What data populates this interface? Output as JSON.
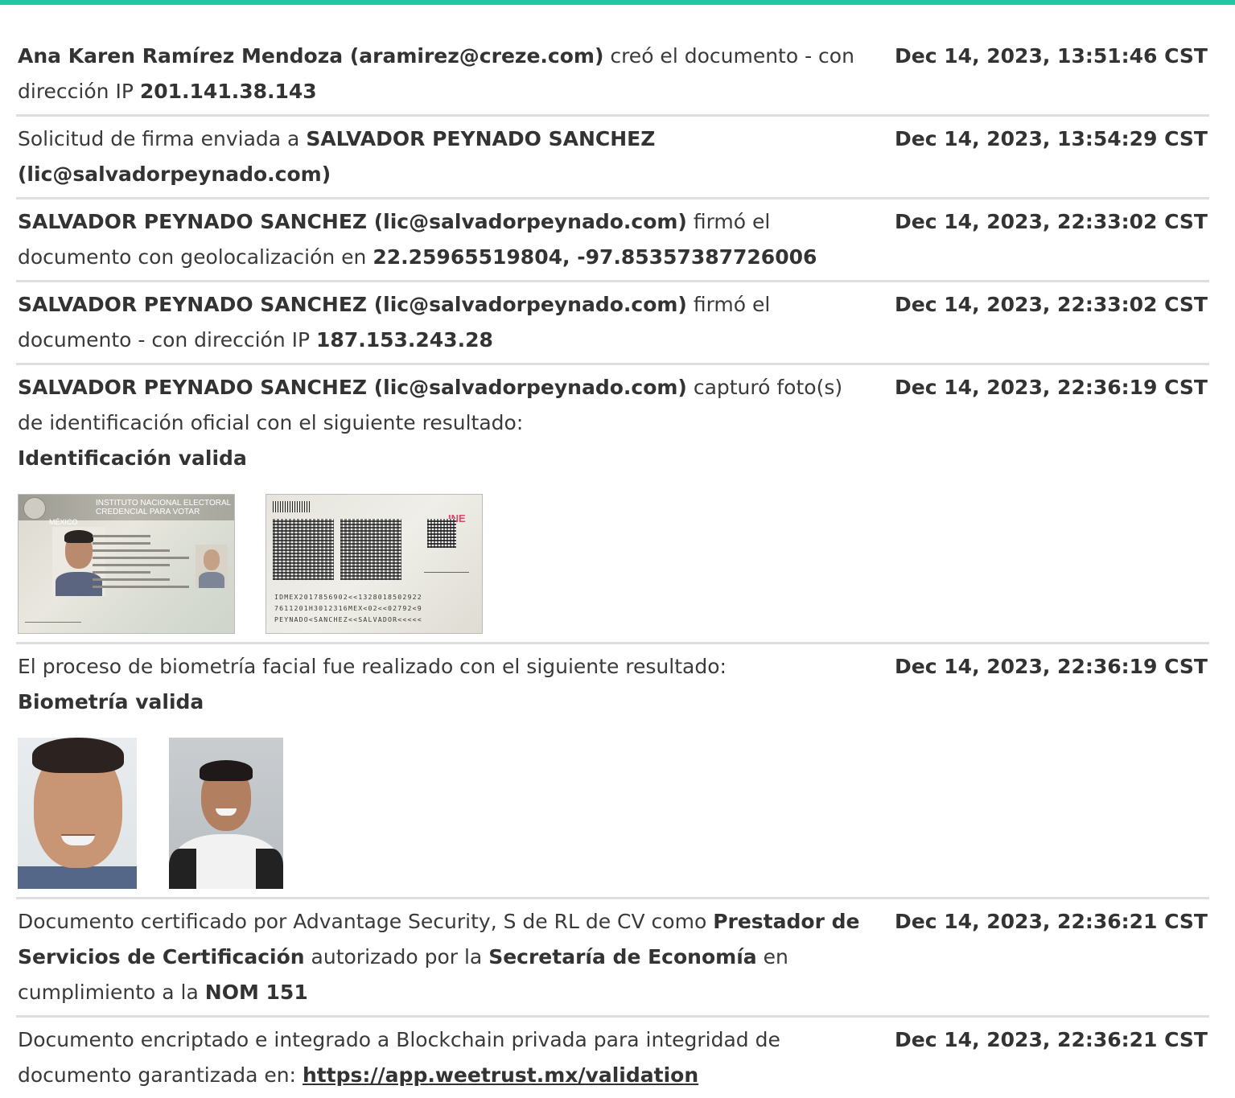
{
  "colors": {
    "accent": "#1fc7a0",
    "divider": "#dedede",
    "text": "#3a3a3a"
  },
  "events": [
    {
      "date": "Dec 14, 2023, 13:51:46 CST",
      "parts": [
        {
          "t": "Ana Karen Ramírez Mendoza (aramirez@creze.com)",
          "b": true
        },
        {
          "t": " creó el documento - con dirección IP ",
          "b": false
        },
        {
          "t": "201.141.38.143",
          "b": true
        }
      ]
    },
    {
      "date": "Dec 14, 2023, 13:54:29 CST",
      "parts": [
        {
          "t": "Solicitud de firma enviada a ",
          "b": false
        },
        {
          "t": "SALVADOR PEYNADO SANCHEZ (lic@salvadorpeynado.com)",
          "b": true
        }
      ]
    },
    {
      "date": "Dec 14, 2023, 22:33:02 CST",
      "parts": [
        {
          "t": "SALVADOR PEYNADO SANCHEZ (lic@salvadorpeynado.com)",
          "b": true
        },
        {
          "t": " firmó el documento con geolocalización en ",
          "b": false
        },
        {
          "t": "22.25965519804, -97.85357387726006",
          "b": true
        }
      ]
    },
    {
      "date": "Dec 14, 2023, 22:33:02 CST",
      "parts": [
        {
          "t": "SALVADOR PEYNADO SANCHEZ (lic@salvadorpeynado.com)",
          "b": true
        },
        {
          "t": " firmó el documento - con dirección IP ",
          "b": false
        },
        {
          "t": "187.153.243.28",
          "b": true
        }
      ]
    },
    {
      "date": "Dec 14, 2023, 22:36:19 CST",
      "parts": [
        {
          "t": "SALVADOR PEYNADO SANCHEZ (lic@salvadorpeynado.com)",
          "b": true
        },
        {
          "t": " capturó foto(s) de identificación oficial con el siguiente resultado:",
          "b": false
        },
        {
          "br": true
        },
        {
          "t": "Identificación valida",
          "b": true
        }
      ],
      "images": "id"
    },
    {
      "date": "Dec 14, 2023, 22:36:19 CST",
      "parts": [
        {
          "t": "El proceso de biometría facial fue realizado con el siguiente resultado:",
          "b": false
        },
        {
          "br": true
        },
        {
          "t": "Biometría valida",
          "b": true
        }
      ],
      "images": "faces"
    },
    {
      "date": "Dec 14, 2023, 22:36:21 CST",
      "parts": [
        {
          "t": "Documento certificado por Advantage Security, S de RL de CV como ",
          "b": false
        },
        {
          "t": "Prestador de Servicios de Certificación",
          "b": true
        },
        {
          "t": " autorizado por la ",
          "b": false
        },
        {
          "t": "Secretaría de Economía",
          "b": true
        },
        {
          "t": " en cumplimiento a la ",
          "b": false
        },
        {
          "t": "NOM 151",
          "b": true
        }
      ]
    },
    {
      "date": "Dec 14, 2023, 22:36:21 CST",
      "parts": [
        {
          "t": "Documento encriptado e integrado a Blockchain privada para integridad de documento garantizada en: ",
          "b": false
        },
        {
          "t": "https://app.weetrust.mx/validation",
          "link": true
        }
      ]
    }
  ],
  "id_card": {
    "front_country": "MÉXICO",
    "front_institution": "INSTITUTO NACIONAL ELECTORAL",
    "front_subtitle": "CREDENCIAL PARA VOTAR",
    "back_logo": "INE",
    "mrz": "IDMEX2017856902<<1328018502922\n7611201H3012316MEX<02<<02792<9\nPEYNADO<SANCHEZ<<SALVADOR<<<<<"
  }
}
